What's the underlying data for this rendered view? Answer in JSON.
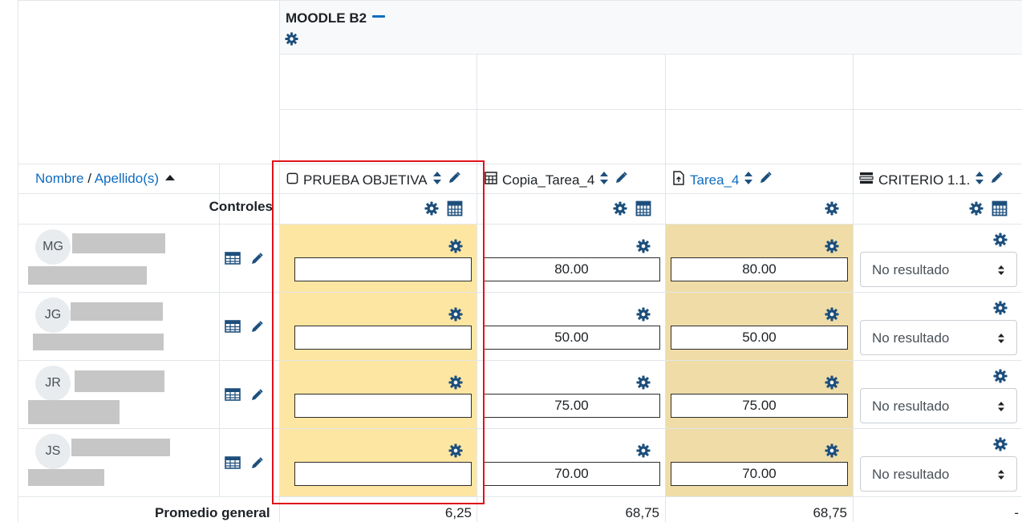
{
  "category": {
    "title": "MOODLE B2"
  },
  "name_header": {
    "first": "Nombre",
    "separator": " / ",
    "last": "Apellido(s)"
  },
  "columns": [
    {
      "label": "PRUEBA OBJETIVA",
      "type_icon": "checkbox-square-icon",
      "is_link": false
    },
    {
      "label": "Copia_Tarea_4",
      "type_icon": "calculator-grid-icon",
      "is_link": false
    },
    {
      "label": "Tarea_4",
      "type_icon": "assignment-file-icon",
      "is_link": true
    },
    {
      "label": "CRITERIO 1.1.",
      "type_icon": "category-list-icon",
      "is_link": false
    }
  ],
  "controls_label": "Controles",
  "students": [
    {
      "initials": "MG",
      "grades": [
        "",
        "80.00",
        "80.00"
      ],
      "outcome": "No resultado"
    },
    {
      "initials": "JG",
      "grades": [
        "",
        "50.00",
        "50.00"
      ],
      "outcome": "No resultado"
    },
    {
      "initials": "JR",
      "grades": [
        "",
        "75.00",
        "75.00"
      ],
      "outcome": "No resultado"
    },
    {
      "initials": "JS",
      "grades": [
        "",
        "70.00",
        "70.00"
      ],
      "outcome": "No resultado"
    }
  ],
  "footer": {
    "label": "Promedio general",
    "values": [
      "6,25",
      "68,75",
      "68,75",
      "-"
    ]
  },
  "colors": {
    "accent": "#0f6cbf",
    "icon": "#1d4f7c",
    "highlight": "#e0121a",
    "overridden": "#fde6a2",
    "locked": "#efdca7"
  }
}
